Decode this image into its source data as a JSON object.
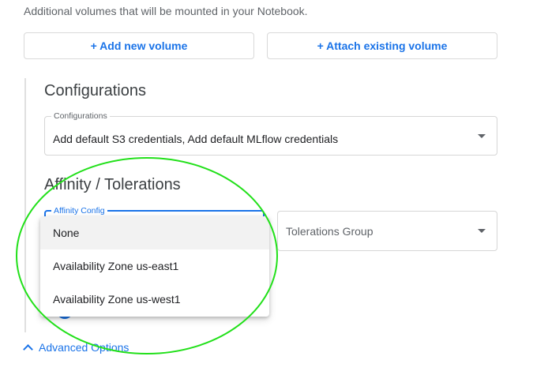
{
  "volumes": {
    "description": "Additional volumes that will be mounted in your Notebook.",
    "add_button": "+ Add new volume",
    "attach_button": "+ Attach existing volume"
  },
  "configurations": {
    "section_title": "Configurations",
    "field_label": "Configurations",
    "field_value": "Add default S3 credentials, Add default MLflow credentials"
  },
  "affinity": {
    "section_title": "Affinity / Tolerations",
    "affinity_label": "Affinity Config",
    "tolerations_placeholder": "Tolerations Group",
    "options": [
      "None",
      "Availability Zone us-east1",
      "Availability Zone us-west1"
    ],
    "selected_option": "None"
  },
  "advanced": {
    "label": "Advanced Options",
    "icon": "chevron-up-icon"
  },
  "colors": {
    "accent": "#1a73e8",
    "annotation": "#22e01a"
  }
}
